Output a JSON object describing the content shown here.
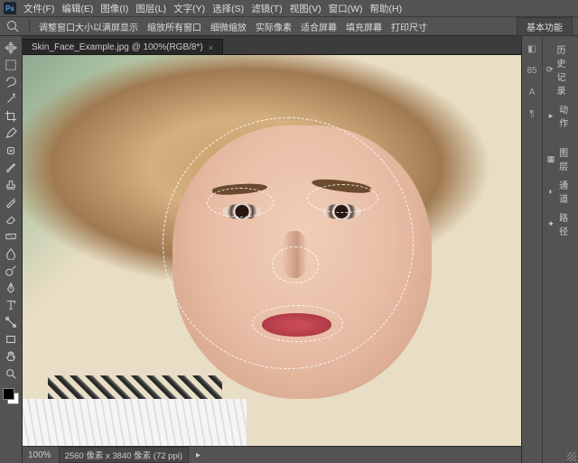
{
  "menubar": {
    "items": [
      "文件(F)",
      "编辑(E)",
      "图像(I)",
      "图层(L)",
      "文字(Y)",
      "选择(S)",
      "滤镜(T)",
      "视图(V)",
      "窗口(W)",
      "帮助(H)"
    ],
    "logo": "Ps"
  },
  "optbar": {
    "items": [
      "调整窗口大小以满屏显示",
      "缩放所有窗口",
      "细微缩放",
      "实际像素",
      "适合屏幕",
      "填充屏幕",
      "打印尺寸"
    ],
    "workspace": "基本功能"
  },
  "tab": {
    "title": "Skin_Face_Example.jpg @ 100%(RGB/8*)"
  },
  "status": {
    "zoom": "100%",
    "docinfo": "2560 像素 x 3840 像素 (72 ppi)"
  },
  "tools": [
    "move",
    "marquee",
    "lasso",
    "wand",
    "crop",
    "eyedropper",
    "heal",
    "brush",
    "stamp",
    "history",
    "eraser",
    "gradient",
    "blur",
    "dodge",
    "pen",
    "type",
    "path",
    "rect",
    "hand",
    "zoom"
  ],
  "rstrip": [
    "◧",
    "85",
    "A",
    "¶"
  ],
  "rpanel": {
    "items": [
      {
        "icon": "⟳",
        "label": "历史记录"
      },
      {
        "icon": "▸",
        "label": "动作"
      },
      {
        "icon": "▦",
        "label": "图层"
      },
      {
        "icon": "◐",
        "label": "通道"
      },
      {
        "icon": "✦",
        "label": "路径"
      }
    ]
  }
}
